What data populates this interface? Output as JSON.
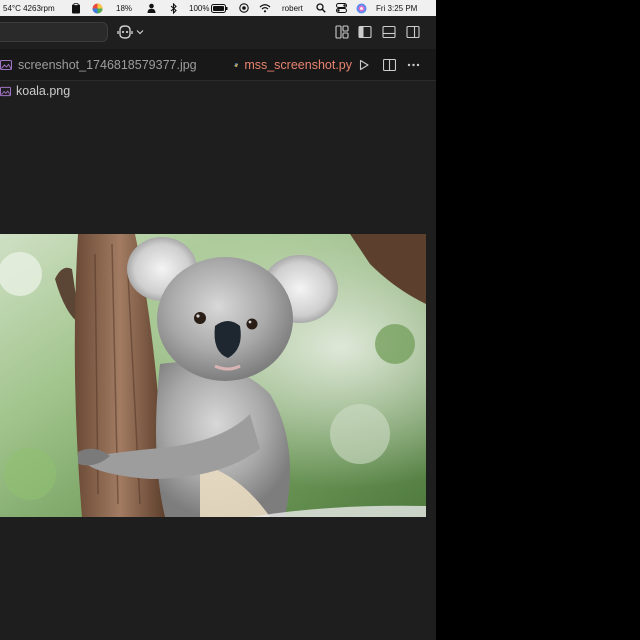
{
  "menubar": {
    "sensor_text": "54°C 4263rpm",
    "cpu_percent": "18%",
    "battery_percent": "100%",
    "user_name": "robert",
    "clock": "Fri 3:25 PM"
  },
  "tabs": [
    {
      "label": "screenshot_1746818579377.jpg",
      "icon": "image-file-icon",
      "active": false
    },
    {
      "label": "mss_screenshot.py",
      "icon": "python-file-icon",
      "active": true
    }
  ],
  "breadcrumb": {
    "file_label": "koala.png",
    "icon": "image-file-icon"
  },
  "image_preview": {
    "subject": "koala",
    "file": "koala.png"
  },
  "colors": {
    "editor_bg": "#1e1e1e",
    "tab_bar_bg": "#181818",
    "active_tab_text": "#e8836f",
    "inactive_tab_text": "#9d9d9d",
    "menubar_bg": "#f0f0f0"
  }
}
